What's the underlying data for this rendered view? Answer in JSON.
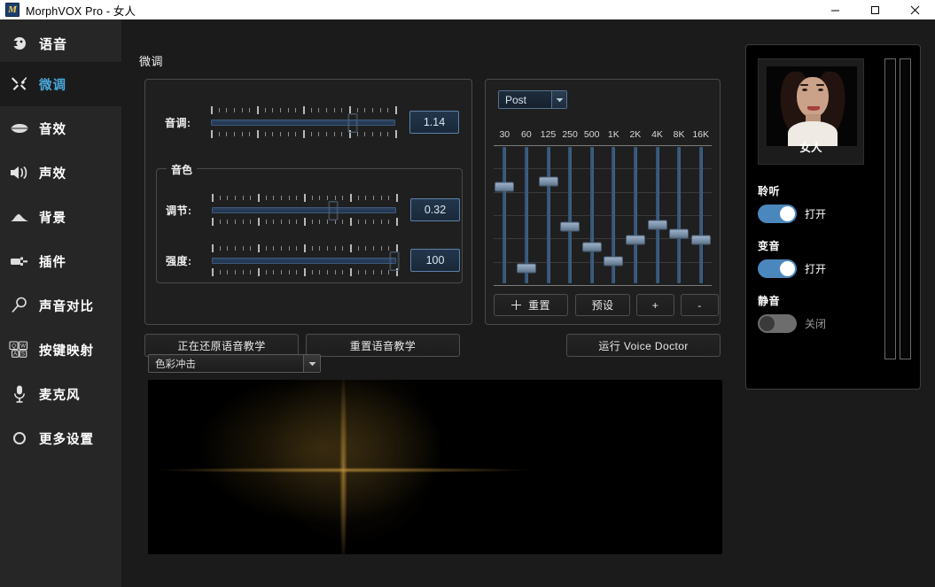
{
  "window": {
    "title": "MorphVOX Pro - 女人",
    "icon": "M",
    "minimize": "minimize-icon",
    "maximize": "maximize-icon",
    "close": "close-icon"
  },
  "sidebar": {
    "sections": [
      {
        "label": "语音",
        "icon": "head-profile-icon"
      }
    ],
    "items": [
      {
        "label": "微调",
        "icon": "wrench-tools-icon",
        "active": true,
        "sub": true
      },
      {
        "label": "音效",
        "icon": "lips-icon",
        "active": false,
        "sub": true
      },
      {
        "label": "声效",
        "icon": "speaker-icon",
        "active": false
      },
      {
        "label": "背景",
        "icon": "mountain-icon",
        "active": false
      },
      {
        "label": "插件",
        "icon": "plug-icon",
        "active": false
      },
      {
        "label": "声音对比",
        "icon": "magnifier-icon",
        "active": false
      },
      {
        "label": "按键映射",
        "icon": "keyboard-keys-icon",
        "active": false
      },
      {
        "label": "麦克风",
        "icon": "microphone-icon",
        "active": false
      },
      {
        "label": "更多设置",
        "icon": "gear-icon",
        "active": false
      }
    ]
  },
  "page": {
    "title": "微调"
  },
  "tune": {
    "pitch": {
      "label": "音调:",
      "value": "1.14",
      "percent": 77
    },
    "timbre": {
      "legend": "音色",
      "adjust": {
        "label": "调节:",
        "value": "0.32",
        "percent": 66
      },
      "strength": {
        "label": "强度:",
        "value": "100",
        "percent": 99
      }
    },
    "buttons": {
      "restore": "正在还原语音教学",
      "reset": "重置语音教学",
      "doctor": "运行 Voice Doctor"
    }
  },
  "equalizer": {
    "mode_select": {
      "value": "Post",
      "arrow": "chevron-down-icon"
    },
    "bands": [
      {
        "freq": "30",
        "pos": 30
      },
      {
        "freq": "60",
        "pos": 88
      },
      {
        "freq": "125",
        "pos": 26
      },
      {
        "freq": "250",
        "pos": 58
      },
      {
        "freq": "500",
        "pos": 73
      },
      {
        "freq": "1K",
        "pos": 83
      },
      {
        "freq": "2K",
        "pos": 68
      },
      {
        "freq": "4K",
        "pos": 57
      },
      {
        "freq": "8K",
        "pos": 63
      },
      {
        "freq": "16K",
        "pos": 68
      }
    ],
    "buttons": {
      "reset": "重置",
      "preset": "预设",
      "plus": "+",
      "minus": "-"
    }
  },
  "visualizer": {
    "select": {
      "value": "色彩冲击",
      "arrow": "chevron-down-icon"
    }
  },
  "voice_card": {
    "name": "女人",
    "toggles": [
      {
        "label": "聆听",
        "state": "打开",
        "on": true
      },
      {
        "label": "变音",
        "state": "打开",
        "on": true
      },
      {
        "label": "静音",
        "state": "关闭",
        "on": false
      }
    ]
  },
  "colors": {
    "accent": "#4aa8dd",
    "toggle_on": "#4a87bd",
    "toggle_off": "#6d6d6d",
    "slider_knob": "#8fa3b9",
    "panel_border": "#4a4a4a",
    "bg": "#1b1b1b",
    "sidebar_bg": "#262626"
  }
}
